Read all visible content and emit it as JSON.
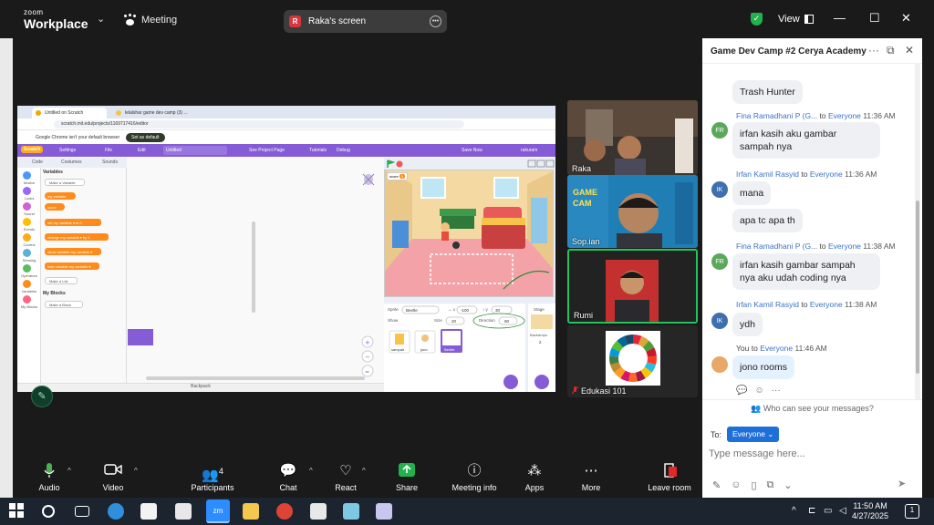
{
  "app": {
    "brand_small": "zoom",
    "brand_main": "Workplace",
    "meeting_label": "Meeting",
    "shared_screen_initial": "R",
    "shared_screen_label": "Raka's screen",
    "view_label": "View"
  },
  "browser": {
    "tab1": "Untitled on Scratch",
    "tab2": "lelalshar game dev camp (3) ...",
    "url": "scratch.mit.edu/projects/1169717416/editor",
    "banner_msg": "Google Chrome isn't your default browser",
    "banner_btn": "Set as default"
  },
  "scratch": {
    "menu": [
      "Settings",
      "File",
      "Edit"
    ],
    "project_title": "Untitled",
    "see_project": "See Project Page",
    "tutorials": "Tutorials",
    "debug": "Debug",
    "save_now": "Save Now",
    "user": "rakuram",
    "tabs": [
      "Code",
      "Costumes",
      "Sounds"
    ],
    "categories": [
      {
        "label": "Motion",
        "color": "#4c97ff"
      },
      {
        "label": "Looks",
        "color": "#9966ff"
      },
      {
        "label": "Sound",
        "color": "#cf63cf"
      },
      {
        "label": "Events",
        "color": "#ffbf00"
      },
      {
        "label": "Control",
        "color": "#ffab19"
      },
      {
        "label": "Sensing",
        "color": "#5cb1d6"
      },
      {
        "label": "Operators",
        "color": "#59c059"
      },
      {
        "label": "Variables",
        "color": "#ff8c1a"
      },
      {
        "label": "My Blocks",
        "color": "#ff6680"
      }
    ],
    "palette_heading": "Variables",
    "make_variable": "Make a Variable",
    "var_my": "my variable",
    "var_score": "score",
    "blk_set": "set my variable ▾ to 0",
    "blk_change": "change my variable ▾ by 1",
    "blk_show": "show variable my variable ▾",
    "blk_hide": "hide variable my variable ▾",
    "make_list": "Make a List",
    "my_blocks_heading": "My Blocks",
    "make_block": "Make a Block",
    "backpack": "Backpack",
    "monitor": "score",
    "sprite_label": "Sprite",
    "sprite_name": "Beetle",
    "x": "-100",
    "y": "30",
    "show": "Show",
    "size_label": "Size",
    "size": "20",
    "direction_label": "Direction",
    "direction": "90",
    "sprites": [
      "sampah",
      "jono",
      "Beetle"
    ],
    "stage_label": "Stage",
    "backdrops_label": "Backdrops",
    "backdrops": "2"
  },
  "participants": [
    {
      "name": "Raka"
    },
    {
      "name": "Sop.ian"
    },
    {
      "name": "Rumi"
    },
    {
      "name": "Edukasi 101"
    }
  ],
  "chat": {
    "title": "Game Dev Camp #2 Cerya Academy",
    "messages": [
      {
        "text": "Trash Hunter"
      },
      {
        "initials": "FR",
        "sender": "Fina Ramadhani P (G...",
        "to": "to",
        "recipient": "Everyone",
        "time": "11:36 AM",
        "text": "irfan kasih aku gambar sampah nya"
      },
      {
        "initials": "IK",
        "sender": "Irfan Kamil Rasyid",
        "to": "to",
        "recipient": "Everyone",
        "time": "11:36 AM",
        "text": "mana"
      },
      {
        "text": "apa tc apa th"
      },
      {
        "initials": "FR",
        "sender": "Fina Ramadhani P (G...",
        "to": "to",
        "recipient": "Everyone",
        "time": "11:38 AM",
        "text": "irfan kasih gambar sampah nya aku udah coding nya"
      },
      {
        "initials": "IK",
        "sender": "Irfan Kamil Rasyid",
        "to": "to",
        "recipient": "Everyone",
        "time": "11:38 AM",
        "text": "ydh"
      },
      {
        "sender": "You",
        "to": "to",
        "recipient": "Everyone",
        "time": "11:46 AM",
        "text": "jono rooms"
      }
    ],
    "who_can_see": "Who can see your messages?",
    "to_label": "To:",
    "to_value": "Everyone",
    "placeholder": "Type message here..."
  },
  "toolbar": {
    "audio": "Audio",
    "video": "Video",
    "participants": "Participants",
    "participants_count": "4",
    "chat": "Chat",
    "react": "React",
    "share": "Share",
    "meeting_info": "Meeting info",
    "apps": "Apps",
    "more": "More",
    "leave": "Leave room"
  },
  "taskbar": {
    "time": "11:50 AM",
    "date": "4/27/2025",
    "notif_count": "1"
  },
  "colors": {
    "zoom_blue": "#0e71eb",
    "share_green": "#22b14c",
    "leave_red": "#e02828",
    "scratch_purple": "#855cd6",
    "active_speaker_border": "#23c45e"
  }
}
